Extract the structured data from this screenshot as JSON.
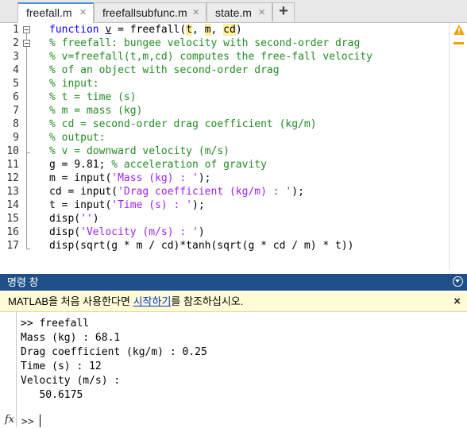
{
  "tabs": [
    {
      "label": "freefall.m",
      "active": true
    },
    {
      "label": "freefallsubfunc.m",
      "active": false
    },
    {
      "label": "state.m",
      "active": false
    }
  ],
  "tab_close_glyph": "×",
  "new_tab_glyph": "+",
  "editor": {
    "line_numbers": [
      "1",
      "2",
      "3",
      "4",
      "5",
      "6",
      "7",
      "8",
      "9",
      "10",
      "11",
      "12",
      "13",
      "14",
      "15",
      "16",
      "17"
    ],
    "lines": {
      "l1": {
        "kw": "function",
        "a": " ",
        "v": "v",
        "b": " = freefall(",
        "t": "t",
        "c1": ", ",
        "m": "m",
        "c2": ", ",
        "cd": "cd",
        "end": ")"
      },
      "l2": "% freefall: bungee velocity with second-order drag",
      "l3": "% v=freefall(t,m,cd) computes the free-fall velocity",
      "l4": "% of an object with second-order drag",
      "l5": "% input:",
      "l6": "% t = time (s)",
      "l7": "% m = mass (kg)",
      "l8": "% cd = second-order drag coefficient (kg/m)",
      "l9": "% output:",
      "l10": "% v = downward velocity (m/s)",
      "l11": {
        "code": "g = 9.81; ",
        "comment": "% acceleration of gravity"
      },
      "l12": {
        "pre": "m = input(",
        "str": "'Mass (kg) : '",
        "post": ");"
      },
      "l13": {
        "pre": "cd = input(",
        "str": "'Drag coefficient (kg/m) : '",
        "post": ");"
      },
      "l14": {
        "pre": "t = input(",
        "str": "'Time (s) : '",
        "post": ");"
      },
      "l15": {
        "pre": "disp(",
        "str": "''",
        "post": ")"
      },
      "l16": {
        "pre": "disp(",
        "str": "'Velocity (m/s) : '",
        "post": ")"
      },
      "l17": "disp(sqrt(g * m / cd)*tanh(sqrt(g * cd / m) * t))"
    },
    "warning_icon": "warning-icon"
  },
  "command_window": {
    "title": "명령 창",
    "notice": {
      "before": "MATLAB을 처음 사용한다면 ",
      "link": "시작하기",
      "after": "를 참조하십시오.",
      "close": "×"
    },
    "output": [
      ">> freefall",
      "Mass (kg) : 68.1",
      "Drag coefficient (kg/m) : 0.25",
      "Time (s) : 12",
      "Velocity (m/s) :",
      "   50.6175"
    ],
    "fx_label": "fx",
    "prompt": ">>"
  },
  "colors": {
    "keyword": "#0e00ff",
    "comment": "#228b22",
    "string": "#a020f0",
    "header_bg": "#1f4f86",
    "notice_bg": "#fffbd6",
    "highlight": "#ffef9e",
    "warning": "#f0a400"
  }
}
